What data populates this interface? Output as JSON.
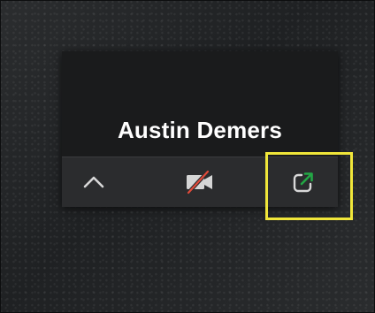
{
  "meeting": {
    "participant_name": "Austin Demers"
  },
  "toolbar": {
    "buttons": [
      {
        "name": "collapse",
        "icon": "chevron-up-icon"
      },
      {
        "name": "video-off",
        "icon": "video-off-icon",
        "accent": "#e14a3a"
      },
      {
        "name": "pop-out",
        "icon": "pop-out-icon",
        "accent": "#23a745"
      }
    ]
  },
  "highlight_color": "#f0e63a"
}
